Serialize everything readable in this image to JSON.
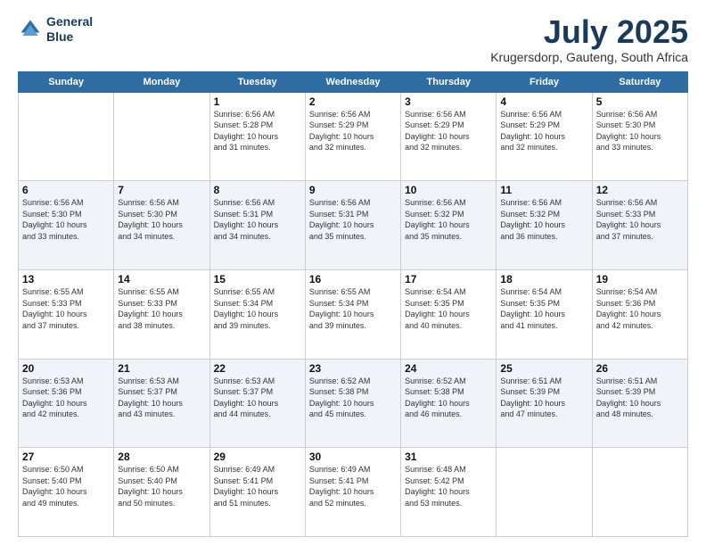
{
  "header": {
    "logo_line1": "General",
    "logo_line2": "Blue",
    "title": "July 2025",
    "location": "Krugersdorp, Gauteng, South Africa"
  },
  "weekdays": [
    "Sunday",
    "Monday",
    "Tuesday",
    "Wednesday",
    "Thursday",
    "Friday",
    "Saturday"
  ],
  "weeks": [
    [
      {
        "day": "",
        "info": ""
      },
      {
        "day": "",
        "info": ""
      },
      {
        "day": "1",
        "info": "Sunrise: 6:56 AM\nSunset: 5:28 PM\nDaylight: 10 hours\nand 31 minutes."
      },
      {
        "day": "2",
        "info": "Sunrise: 6:56 AM\nSunset: 5:29 PM\nDaylight: 10 hours\nand 32 minutes."
      },
      {
        "day": "3",
        "info": "Sunrise: 6:56 AM\nSunset: 5:29 PM\nDaylight: 10 hours\nand 32 minutes."
      },
      {
        "day": "4",
        "info": "Sunrise: 6:56 AM\nSunset: 5:29 PM\nDaylight: 10 hours\nand 32 minutes."
      },
      {
        "day": "5",
        "info": "Sunrise: 6:56 AM\nSunset: 5:30 PM\nDaylight: 10 hours\nand 33 minutes."
      }
    ],
    [
      {
        "day": "6",
        "info": "Sunrise: 6:56 AM\nSunset: 5:30 PM\nDaylight: 10 hours\nand 33 minutes."
      },
      {
        "day": "7",
        "info": "Sunrise: 6:56 AM\nSunset: 5:30 PM\nDaylight: 10 hours\nand 34 minutes."
      },
      {
        "day": "8",
        "info": "Sunrise: 6:56 AM\nSunset: 5:31 PM\nDaylight: 10 hours\nand 34 minutes."
      },
      {
        "day": "9",
        "info": "Sunrise: 6:56 AM\nSunset: 5:31 PM\nDaylight: 10 hours\nand 35 minutes."
      },
      {
        "day": "10",
        "info": "Sunrise: 6:56 AM\nSunset: 5:32 PM\nDaylight: 10 hours\nand 35 minutes."
      },
      {
        "day": "11",
        "info": "Sunrise: 6:56 AM\nSunset: 5:32 PM\nDaylight: 10 hours\nand 36 minutes."
      },
      {
        "day": "12",
        "info": "Sunrise: 6:56 AM\nSunset: 5:33 PM\nDaylight: 10 hours\nand 37 minutes."
      }
    ],
    [
      {
        "day": "13",
        "info": "Sunrise: 6:55 AM\nSunset: 5:33 PM\nDaylight: 10 hours\nand 37 minutes."
      },
      {
        "day": "14",
        "info": "Sunrise: 6:55 AM\nSunset: 5:33 PM\nDaylight: 10 hours\nand 38 minutes."
      },
      {
        "day": "15",
        "info": "Sunrise: 6:55 AM\nSunset: 5:34 PM\nDaylight: 10 hours\nand 39 minutes."
      },
      {
        "day": "16",
        "info": "Sunrise: 6:55 AM\nSunset: 5:34 PM\nDaylight: 10 hours\nand 39 minutes."
      },
      {
        "day": "17",
        "info": "Sunrise: 6:54 AM\nSunset: 5:35 PM\nDaylight: 10 hours\nand 40 minutes."
      },
      {
        "day": "18",
        "info": "Sunrise: 6:54 AM\nSunset: 5:35 PM\nDaylight: 10 hours\nand 41 minutes."
      },
      {
        "day": "19",
        "info": "Sunrise: 6:54 AM\nSunset: 5:36 PM\nDaylight: 10 hours\nand 42 minutes."
      }
    ],
    [
      {
        "day": "20",
        "info": "Sunrise: 6:53 AM\nSunset: 5:36 PM\nDaylight: 10 hours\nand 42 minutes."
      },
      {
        "day": "21",
        "info": "Sunrise: 6:53 AM\nSunset: 5:37 PM\nDaylight: 10 hours\nand 43 minutes."
      },
      {
        "day": "22",
        "info": "Sunrise: 6:53 AM\nSunset: 5:37 PM\nDaylight: 10 hours\nand 44 minutes."
      },
      {
        "day": "23",
        "info": "Sunrise: 6:52 AM\nSunset: 5:38 PM\nDaylight: 10 hours\nand 45 minutes."
      },
      {
        "day": "24",
        "info": "Sunrise: 6:52 AM\nSunset: 5:38 PM\nDaylight: 10 hours\nand 46 minutes."
      },
      {
        "day": "25",
        "info": "Sunrise: 6:51 AM\nSunset: 5:39 PM\nDaylight: 10 hours\nand 47 minutes."
      },
      {
        "day": "26",
        "info": "Sunrise: 6:51 AM\nSunset: 5:39 PM\nDaylight: 10 hours\nand 48 minutes."
      }
    ],
    [
      {
        "day": "27",
        "info": "Sunrise: 6:50 AM\nSunset: 5:40 PM\nDaylight: 10 hours\nand 49 minutes."
      },
      {
        "day": "28",
        "info": "Sunrise: 6:50 AM\nSunset: 5:40 PM\nDaylight: 10 hours\nand 50 minutes."
      },
      {
        "day": "29",
        "info": "Sunrise: 6:49 AM\nSunset: 5:41 PM\nDaylight: 10 hours\nand 51 minutes."
      },
      {
        "day": "30",
        "info": "Sunrise: 6:49 AM\nSunset: 5:41 PM\nDaylight: 10 hours\nand 52 minutes."
      },
      {
        "day": "31",
        "info": "Sunrise: 6:48 AM\nSunset: 5:42 PM\nDaylight: 10 hours\nand 53 minutes."
      },
      {
        "day": "",
        "info": ""
      },
      {
        "day": "",
        "info": ""
      }
    ]
  ]
}
